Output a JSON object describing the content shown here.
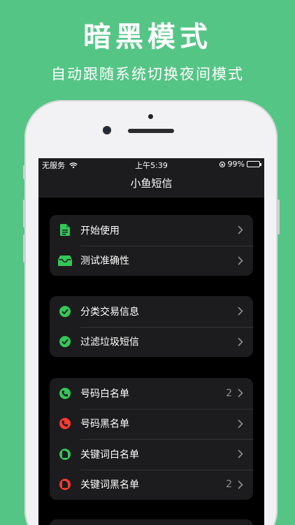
{
  "promo": {
    "headline": "暗黑模式",
    "subline": "自动跟随系统切换夜间模式"
  },
  "colors": {
    "background": "#55c586",
    "green": "#34c759",
    "red": "#ff3b30",
    "cell": "#1c1c1e"
  },
  "status_bar": {
    "carrier": "无服务",
    "time": "上午5:39",
    "battery": "99%"
  },
  "nav": {
    "title": "小鱼短信"
  },
  "groups": [
    {
      "rows": [
        {
          "label": "开始使用",
          "icon": "document-icon",
          "count": ""
        },
        {
          "label": "测试准确性",
          "icon": "inbox-tray-icon",
          "count": ""
        }
      ]
    },
    {
      "rows": [
        {
          "label": "分类交易信息",
          "icon": "checkmark-circle-icon",
          "count": ""
        },
        {
          "label": "过滤垃圾短信",
          "icon": "checkmark-circle-icon",
          "count": ""
        }
      ]
    },
    {
      "rows": [
        {
          "label": "号码白名单",
          "icon": "phone-green-icon",
          "count": "2"
        },
        {
          "label": "号码黑名单",
          "icon": "phone-red-icon",
          "count": ""
        },
        {
          "label": "关键词白名单",
          "icon": "file-green-icon",
          "count": ""
        },
        {
          "label": "关键词黑名单",
          "icon": "file-red-icon",
          "count": "2"
        }
      ]
    }
  ]
}
